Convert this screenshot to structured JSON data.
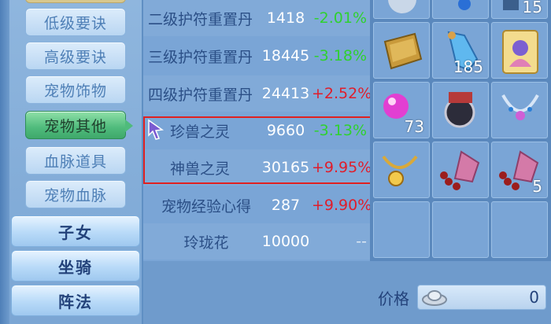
{
  "sidebar": {
    "subcategories": [
      {
        "label": "低级要诀"
      },
      {
        "label": "高级要诀"
      },
      {
        "label": "宠物饰物"
      },
      {
        "label": "宠物其他"
      },
      {
        "label": "血脉道具"
      },
      {
        "label": "宠物血脉"
      }
    ],
    "main_categories": [
      {
        "label": "子女"
      },
      {
        "label": "坐骑"
      },
      {
        "label": "阵法"
      }
    ]
  },
  "list": {
    "rows": [
      {
        "name": "二级护符重置丹",
        "price": "1418",
        "change": "-2.01%"
      },
      {
        "name": "三级护符重置丹",
        "price": "18445",
        "change": "-3.18%"
      },
      {
        "name": "四级护符重置丹",
        "price": "24413",
        "change": "+2.52%"
      },
      {
        "name": "珍兽之灵",
        "price": "9660",
        "change": "-3.13%"
      },
      {
        "name": "神兽之灵",
        "price": "30165",
        "change": "+9.95%"
      },
      {
        "name": "宠物经验心得",
        "price": "287",
        "change": "+9.90%"
      },
      {
        "name": "玲珑花",
        "price": "10000",
        "change": "--"
      }
    ]
  },
  "inventory": {
    "slots": [
      {
        "icon": "item-icon",
        "qty": ""
      },
      {
        "icon": "item-icon",
        "qty": ""
      },
      {
        "icon": "item-icon",
        "qty": "15"
      },
      {
        "icon": "gold-bar-icon",
        "qty": ""
      },
      {
        "icon": "blue-flask-icon",
        "qty": "185"
      },
      {
        "icon": "pet-card-icon",
        "qty": ""
      },
      {
        "icon": "pink-orb-icon",
        "qty": "73"
      },
      {
        "icon": "dark-orb-icon",
        "qty": ""
      },
      {
        "icon": "necklace-icon",
        "qty": ""
      },
      {
        "icon": "gold-necklace-icon",
        "qty": ""
      },
      {
        "icon": "flower-icon",
        "qty": ""
      },
      {
        "icon": "flower-icon",
        "qty": "5"
      },
      {
        "icon": "empty",
        "qty": ""
      },
      {
        "icon": "empty",
        "qty": ""
      },
      {
        "icon": "empty",
        "qty": ""
      }
    ]
  },
  "price": {
    "label": "价格",
    "value": "0"
  },
  "colors": {
    "up": "#e01d2b",
    "down": "#2fd12f",
    "selection": "#e02020"
  }
}
